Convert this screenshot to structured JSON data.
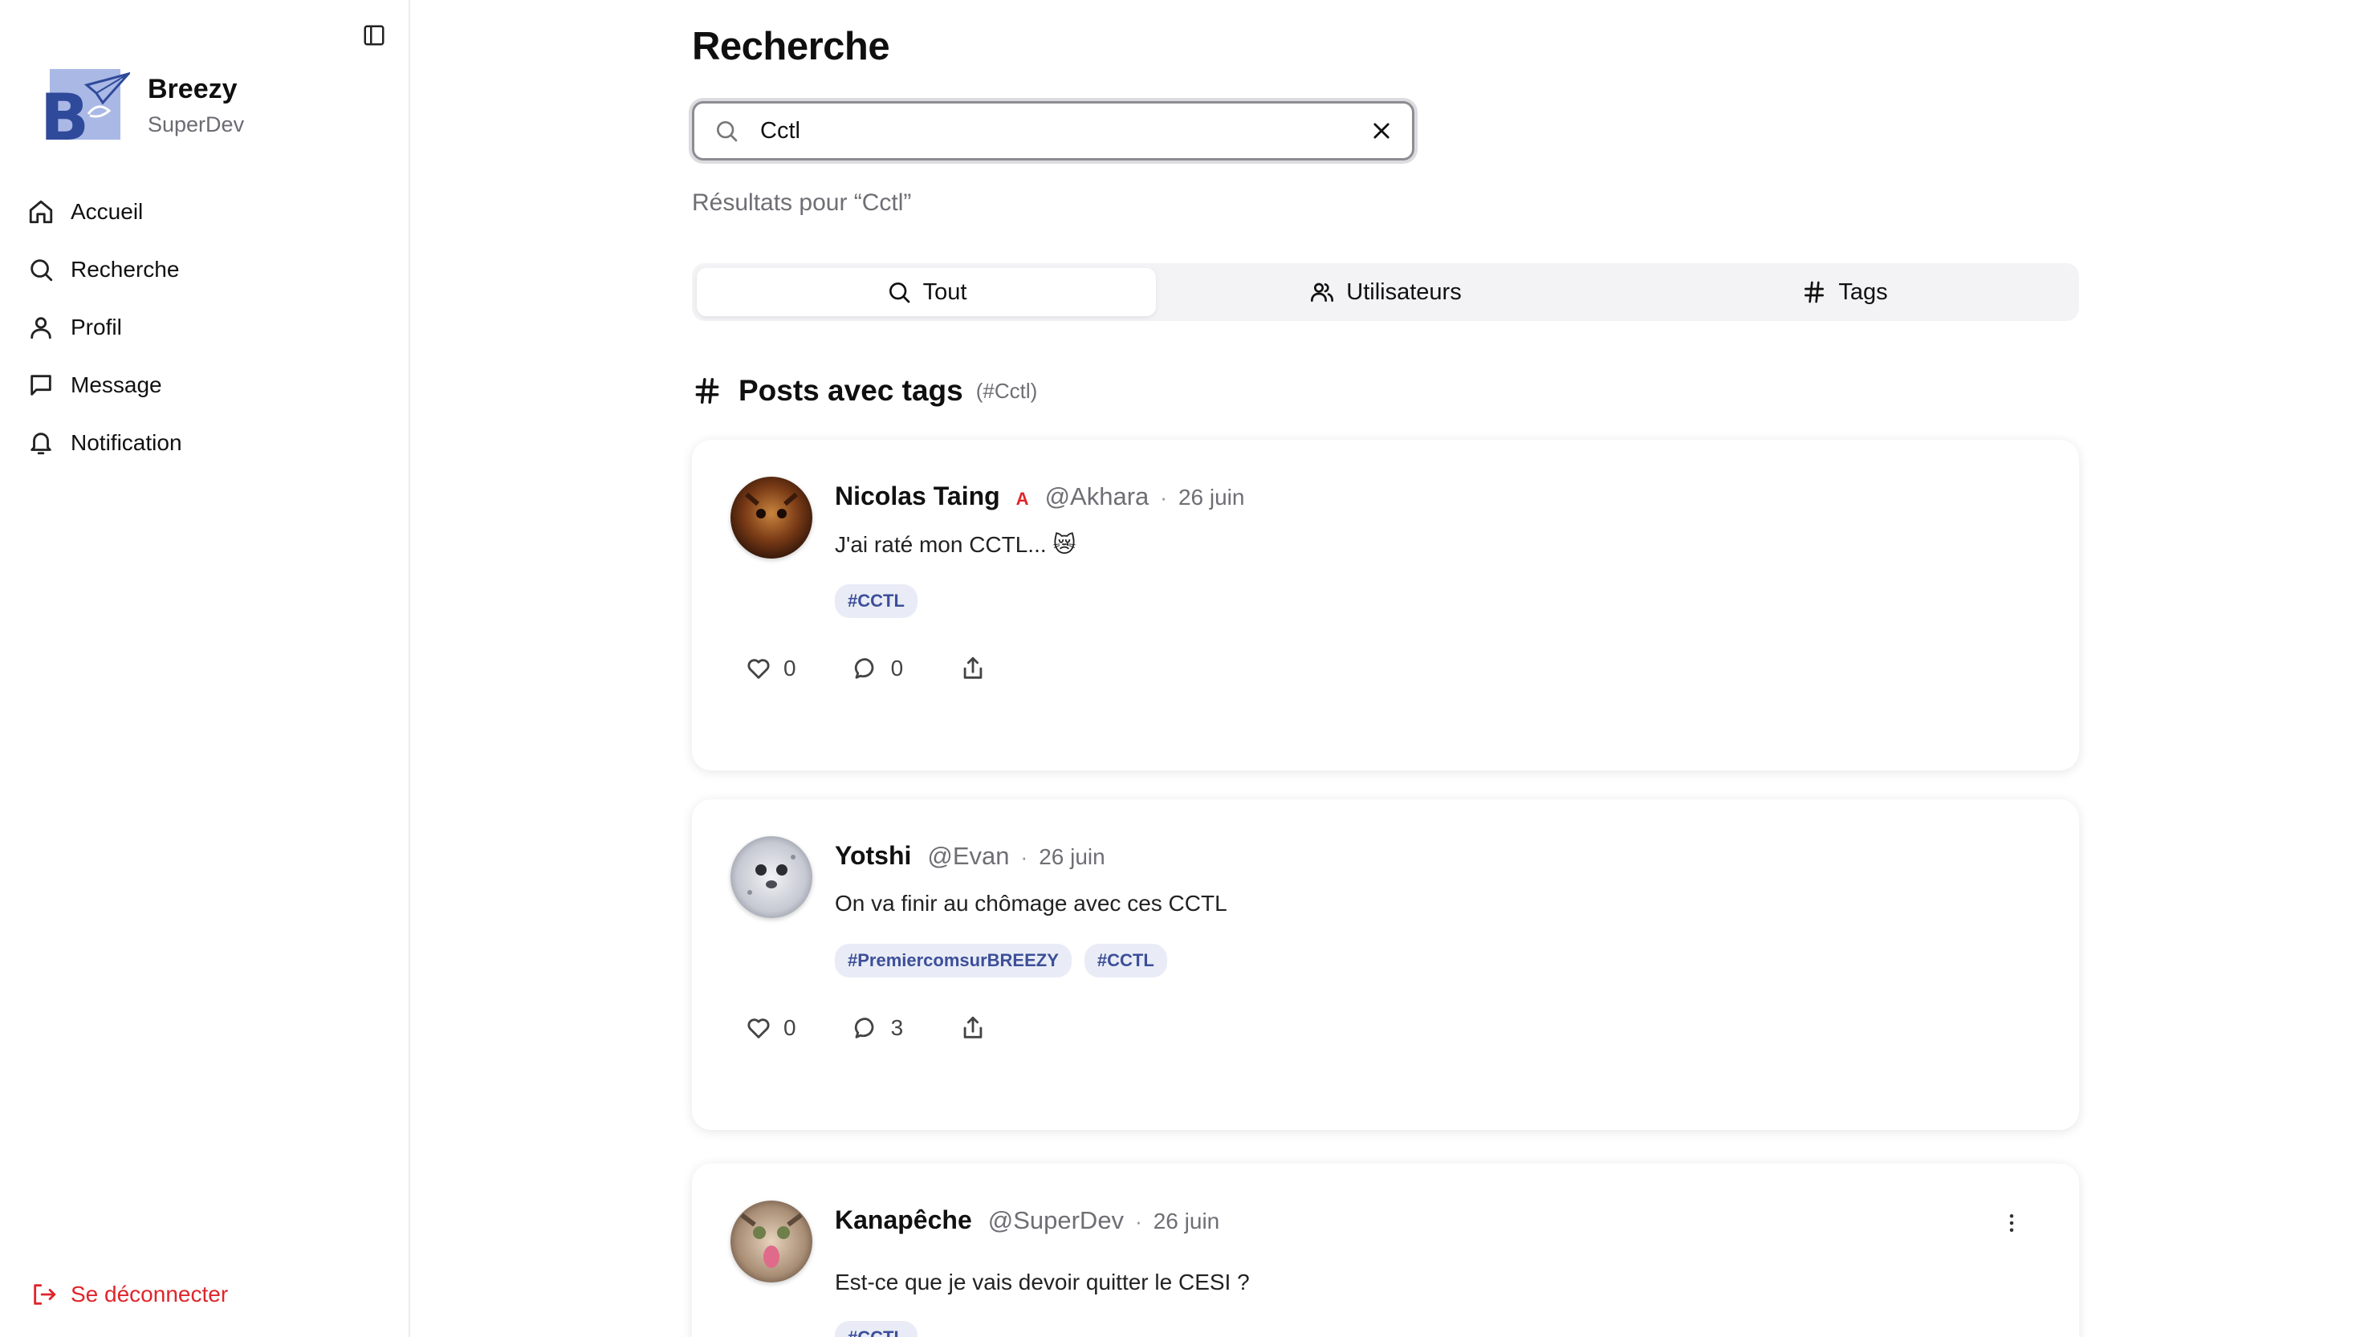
{
  "app": {
    "name": "Breezy",
    "user": "SuperDev"
  },
  "nav": {
    "items": [
      {
        "label": "Accueil",
        "icon": "home-icon"
      },
      {
        "label": "Recherche",
        "icon": "search-icon"
      },
      {
        "label": "Profil",
        "icon": "user-icon"
      },
      {
        "label": "Message",
        "icon": "message-icon"
      },
      {
        "label": "Notification",
        "icon": "bell-icon"
      }
    ],
    "logout_label": "Se déconnecter"
  },
  "page": {
    "title": "Recherche",
    "search_value": "Cctl",
    "results_label": "Résultats pour “Cctl”"
  },
  "tabs": [
    {
      "label": "Tout",
      "icon": "search-icon",
      "active": true
    },
    {
      "label": "Utilisateurs",
      "icon": "users-icon",
      "active": false
    },
    {
      "label": "Tags",
      "icon": "hash-icon",
      "active": false
    }
  ],
  "section": {
    "title": "Posts avec tags",
    "term": "(#Cctl)"
  },
  "posts": [
    {
      "author": "Nicolas Taing",
      "badge": "A",
      "handle": "@Akhara",
      "separator": "·",
      "date": "26 juin",
      "text": "J'ai raté mon CCTL... 😿",
      "tags": [
        "#CCTL"
      ],
      "likes": "0",
      "comments": "0"
    },
    {
      "author": "Yotshi",
      "handle": "@Evan",
      "separator": "·",
      "date": "26 juin",
      "text": "On va finir au chômage avec ces CCTL",
      "tags": [
        "#PremiercomsurBREEZY",
        "#CCTL"
      ],
      "likes": "0",
      "comments": "3"
    },
    {
      "author": "Kanapêche",
      "handle": "@SuperDev",
      "separator": "·",
      "date": "26 juin",
      "text": "Est-ce que je vais devoir quitter le CESI ?",
      "tags": [
        "#CCTL"
      ]
    }
  ],
  "colors": {
    "danger": "#e0252b",
    "tag_bg": "#e9ecf6",
    "tag_text": "#3c4f99",
    "logo_blue": "#2f4a9a"
  }
}
